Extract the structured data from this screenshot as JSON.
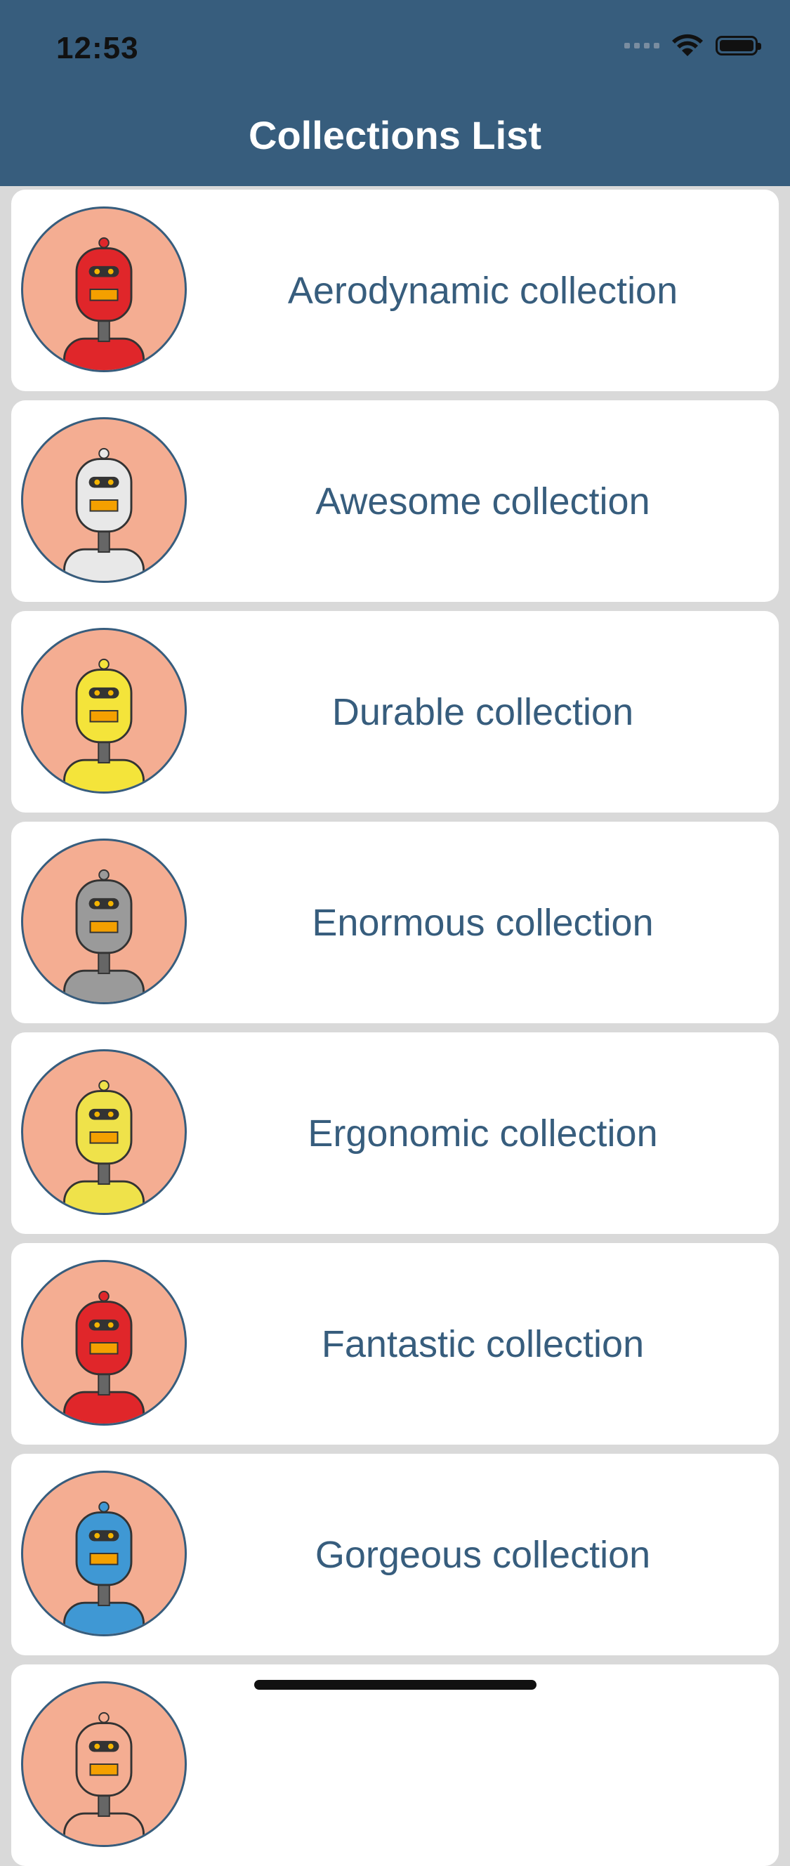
{
  "status_bar": {
    "time": "12:53",
    "icons": [
      "signal-icon",
      "wifi-icon",
      "battery-icon"
    ]
  },
  "nav": {
    "title": "Collections List"
  },
  "colors": {
    "header": "#375d7d",
    "accent_text": "#375d7d",
    "avatar_bg": "#f4ad92",
    "page_bg": "#d9d9d9"
  },
  "collections": [
    {
      "label": "Aerodynamic collection",
      "avatar": "red-robot-avatar",
      "robot_color": "#e0262a"
    },
    {
      "label": "Awesome collection",
      "avatar": "white-robot-avatar",
      "robot_color": "#e8e8e8"
    },
    {
      "label": "Durable collection",
      "avatar": "yellow-robot-avatar",
      "robot_color": "#f4e43a"
    },
    {
      "label": "Enormous collection",
      "avatar": "gray-robot-avatar",
      "robot_color": "#9a9a9a"
    },
    {
      "label": "Ergonomic collection",
      "avatar": "yellow-box-robot-avatar",
      "robot_color": "#efe24a"
    },
    {
      "label": "Fantastic collection",
      "avatar": "red-round-robot-avatar",
      "robot_color": "#e0262a"
    },
    {
      "label": "Gorgeous collection",
      "avatar": "blue-robot-avatar",
      "robot_color": "#3f98d4"
    },
    {
      "label": "",
      "avatar": "partial-robot-avatar",
      "robot_color": "#f4ad92"
    }
  ]
}
